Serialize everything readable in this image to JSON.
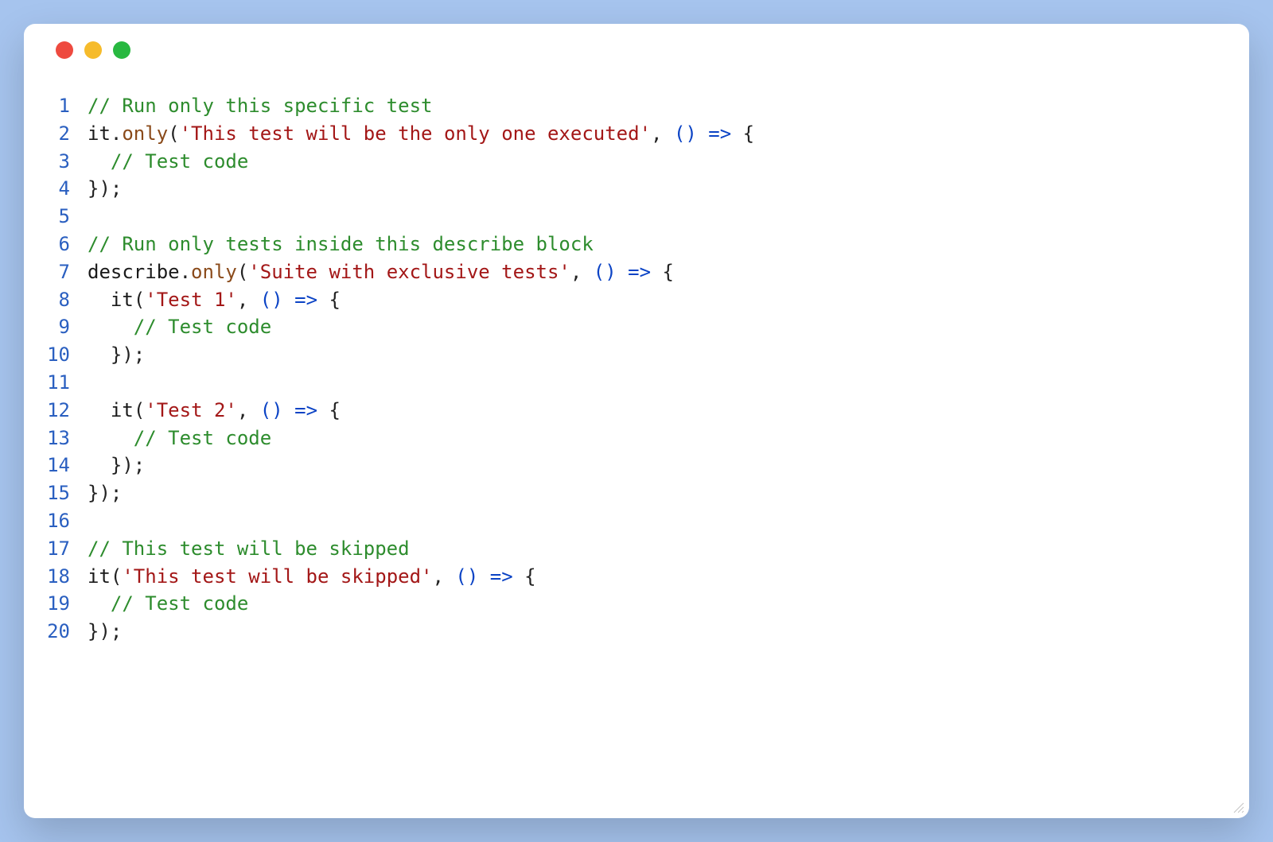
{
  "traffic_lights": [
    "red",
    "yellow",
    "green"
  ],
  "lines": [
    {
      "n": 1,
      "segs": [
        {
          "cls": "c-comment",
          "t": "// Run only this specific test"
        }
      ]
    },
    {
      "n": 2,
      "segs": [
        {
          "cls": "c-ident",
          "t": "it"
        },
        {
          "cls": "c-punc",
          "t": "."
        },
        {
          "cls": "c-method",
          "t": "only"
        },
        {
          "cls": "c-punc",
          "t": "("
        },
        {
          "cls": "c-str",
          "t": "'This test will be the only one executed'"
        },
        {
          "cls": "c-punc",
          "t": ", "
        },
        {
          "cls": "c-paren",
          "t": "()"
        },
        {
          "cls": "c-punc",
          "t": " "
        },
        {
          "cls": "c-arrow",
          "t": "=>"
        },
        {
          "cls": "c-punc",
          "t": " {"
        }
      ]
    },
    {
      "n": 3,
      "segs": [
        {
          "cls": "c-punc",
          "t": "  "
        },
        {
          "cls": "c-comment",
          "t": "// Test code"
        }
      ]
    },
    {
      "n": 4,
      "segs": [
        {
          "cls": "c-punc",
          "t": "});"
        }
      ]
    },
    {
      "n": 5,
      "segs": [
        {
          "cls": "c-punc",
          "t": ""
        }
      ]
    },
    {
      "n": 6,
      "segs": [
        {
          "cls": "c-comment",
          "t": "// Run only tests inside this describe block"
        }
      ]
    },
    {
      "n": 7,
      "segs": [
        {
          "cls": "c-ident",
          "t": "describe"
        },
        {
          "cls": "c-punc",
          "t": "."
        },
        {
          "cls": "c-method",
          "t": "only"
        },
        {
          "cls": "c-punc",
          "t": "("
        },
        {
          "cls": "c-str",
          "t": "'Suite with exclusive tests'"
        },
        {
          "cls": "c-punc",
          "t": ", "
        },
        {
          "cls": "c-paren",
          "t": "()"
        },
        {
          "cls": "c-punc",
          "t": " "
        },
        {
          "cls": "c-arrow",
          "t": "=>"
        },
        {
          "cls": "c-punc",
          "t": " {"
        }
      ]
    },
    {
      "n": 8,
      "segs": [
        {
          "cls": "c-punc",
          "t": "  "
        },
        {
          "cls": "c-ident",
          "t": "it"
        },
        {
          "cls": "c-punc",
          "t": "("
        },
        {
          "cls": "c-str",
          "t": "'Test 1'"
        },
        {
          "cls": "c-punc",
          "t": ", "
        },
        {
          "cls": "c-paren",
          "t": "()"
        },
        {
          "cls": "c-punc",
          "t": " "
        },
        {
          "cls": "c-arrow",
          "t": "=>"
        },
        {
          "cls": "c-punc",
          "t": " {"
        }
      ]
    },
    {
      "n": 9,
      "segs": [
        {
          "cls": "c-punc",
          "t": "    "
        },
        {
          "cls": "c-comment",
          "t": "// Test code"
        }
      ]
    },
    {
      "n": 10,
      "segs": [
        {
          "cls": "c-punc",
          "t": "  });"
        }
      ]
    },
    {
      "n": 11,
      "segs": [
        {
          "cls": "c-punc",
          "t": ""
        }
      ]
    },
    {
      "n": 12,
      "segs": [
        {
          "cls": "c-punc",
          "t": "  "
        },
        {
          "cls": "c-ident",
          "t": "it"
        },
        {
          "cls": "c-punc",
          "t": "("
        },
        {
          "cls": "c-str",
          "t": "'Test 2'"
        },
        {
          "cls": "c-punc",
          "t": ", "
        },
        {
          "cls": "c-paren",
          "t": "()"
        },
        {
          "cls": "c-punc",
          "t": " "
        },
        {
          "cls": "c-arrow",
          "t": "=>"
        },
        {
          "cls": "c-punc",
          "t": " {"
        }
      ]
    },
    {
      "n": 13,
      "segs": [
        {
          "cls": "c-punc",
          "t": "    "
        },
        {
          "cls": "c-comment",
          "t": "// Test code"
        }
      ]
    },
    {
      "n": 14,
      "segs": [
        {
          "cls": "c-punc",
          "t": "  });"
        }
      ]
    },
    {
      "n": 15,
      "segs": [
        {
          "cls": "c-punc",
          "t": "});"
        }
      ]
    },
    {
      "n": 16,
      "segs": [
        {
          "cls": "c-punc",
          "t": ""
        }
      ]
    },
    {
      "n": 17,
      "segs": [
        {
          "cls": "c-comment",
          "t": "// This test will be skipped"
        }
      ]
    },
    {
      "n": 18,
      "segs": [
        {
          "cls": "c-ident",
          "t": "it"
        },
        {
          "cls": "c-punc",
          "t": "("
        },
        {
          "cls": "c-str",
          "t": "'This test will be skipped'"
        },
        {
          "cls": "c-punc",
          "t": ", "
        },
        {
          "cls": "c-paren",
          "t": "()"
        },
        {
          "cls": "c-punc",
          "t": " "
        },
        {
          "cls": "c-arrow",
          "t": "=>"
        },
        {
          "cls": "c-punc",
          "t": " {"
        }
      ]
    },
    {
      "n": 19,
      "segs": [
        {
          "cls": "c-punc",
          "t": "  "
        },
        {
          "cls": "c-comment",
          "t": "// Test code"
        }
      ]
    },
    {
      "n": 20,
      "segs": [
        {
          "cls": "c-punc",
          "t": "});"
        }
      ]
    }
  ]
}
